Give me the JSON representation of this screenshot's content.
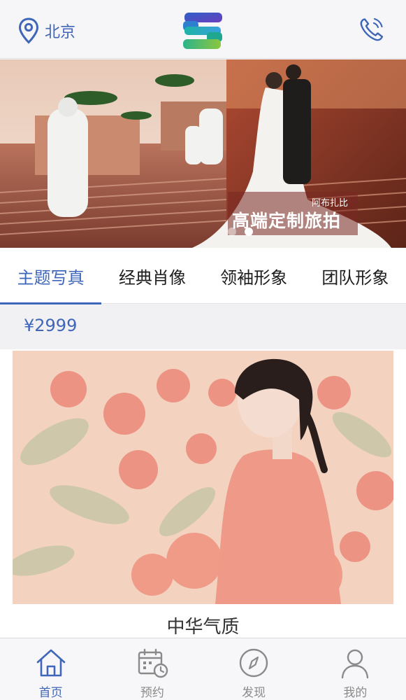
{
  "header": {
    "location": "北京",
    "location_icon": "location-pin-icon",
    "logo_icon": "brand-s-logo",
    "phone_icon": "phone-call-icon"
  },
  "banner": {
    "caption_small": "阿布扎比",
    "caption_main": "高端定制旅拍",
    "slide_count": 2,
    "active_slide": 2
  },
  "tabs": [
    {
      "label": "主题写真",
      "active": true
    },
    {
      "label": "经典肖像",
      "active": false
    },
    {
      "label": "领袖形象",
      "active": false
    },
    {
      "label": "团队形象",
      "active": false
    }
  ],
  "price": "¥2999",
  "card": {
    "title": "中华气质"
  },
  "bottom_nav": [
    {
      "label": "首页",
      "icon": "home-icon",
      "active": true
    },
    {
      "label": "预约",
      "icon": "calendar-clock-icon",
      "active": false
    },
    {
      "label": "发现",
      "icon": "compass-icon",
      "active": false
    },
    {
      "label": "我的",
      "icon": "user-icon",
      "active": false
    }
  ],
  "colors": {
    "accent": "#3f66b8",
    "inactive": "#8a8a8a",
    "text": "#1d1d1d"
  }
}
